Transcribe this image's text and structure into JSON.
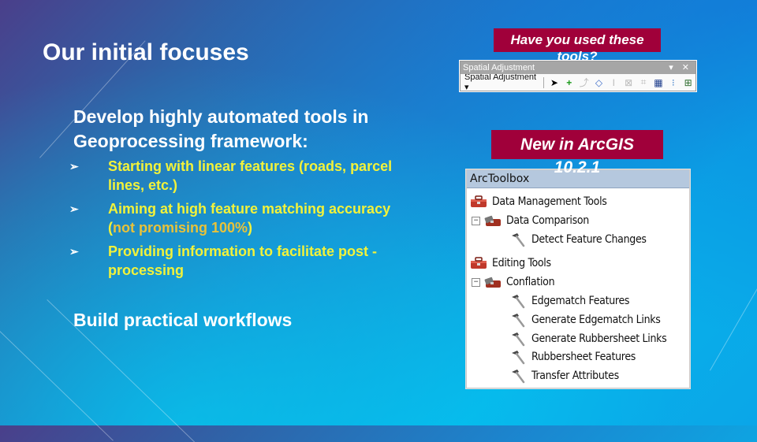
{
  "slide": {
    "title": "Our initial focuses",
    "subheading": "Develop highly automated tools in Geoprocessing framework:",
    "bullets": [
      {
        "text": "Starting with linear features (roads, parcel lines, etc.)"
      },
      {
        "prefix": "Aiming at high feature matching accuracy (",
        "highlight": "not promising 100%",
        "suffix": ")"
      },
      {
        "text": "Providing information to facilitate post -processing"
      }
    ],
    "bullet_glyph": "➢",
    "workflows": "Build practical workflows",
    "colors": {
      "callout_bg": "#a0003a",
      "bullet_text": "#f2f23a",
      "highlight_text": "#e8c23a"
    }
  },
  "callouts": {
    "tools_question_line1": "Have you used these",
    "tools_question_line2": "tools?",
    "new_in_line1": "New in ArcGIS",
    "new_in_line2": "10.2.1"
  },
  "spatial_adjustment": {
    "title": "Spatial Adjustment",
    "window_controls": "▾ ✕",
    "menu_label": "Spatial Adjustment ▾",
    "tools": [
      {
        "icon": "select-elements-icon",
        "glyph": "➤"
      },
      {
        "icon": "new-displacement-link-icon",
        "glyph": "+"
      },
      {
        "icon": "modify-link-icon",
        "glyph": "⤴"
      },
      {
        "icon": "multi-displacement-links-icon",
        "glyph": "◇"
      },
      {
        "icon": "new-identity-link-icon",
        "glyph": "I"
      },
      {
        "icon": "new-limited-adjustment-area-icon",
        "glyph": "⊠"
      },
      {
        "icon": "clear-limited-adjustment-area-icon",
        "glyph": "⌗"
      },
      {
        "icon": "view-link-table-icon",
        "glyph": "▦"
      },
      {
        "icon": "adjustment-preview-icon",
        "glyph": "⁝"
      },
      {
        "icon": "attribute-transfer-icon",
        "glyph": "⊞"
      }
    ]
  },
  "arctoolbox": {
    "title": "ArcToolbox",
    "items": [
      {
        "label": "Data Management Tools",
        "type": "toolbox",
        "level": 0
      },
      {
        "label": "Data Comparison",
        "type": "toolset",
        "level": 1,
        "expander": "−"
      },
      {
        "label": "Detect Feature Changes",
        "type": "tool",
        "level": 2
      },
      {
        "label": "Editing Tools",
        "type": "toolbox",
        "level": 0
      },
      {
        "label": "Conflation",
        "type": "toolset",
        "level": 1,
        "expander": "−"
      },
      {
        "label": "Edgematch Features",
        "type": "tool",
        "level": 2
      },
      {
        "label": "Generate Edgematch Links",
        "type": "tool",
        "level": 2
      },
      {
        "label": "Generate Rubbersheet Links",
        "type": "tool",
        "level": 2
      },
      {
        "label": "Rubbersheet Features",
        "type": "tool",
        "level": 2
      },
      {
        "label": "Transfer Attributes",
        "type": "tool",
        "level": 2
      }
    ]
  }
}
